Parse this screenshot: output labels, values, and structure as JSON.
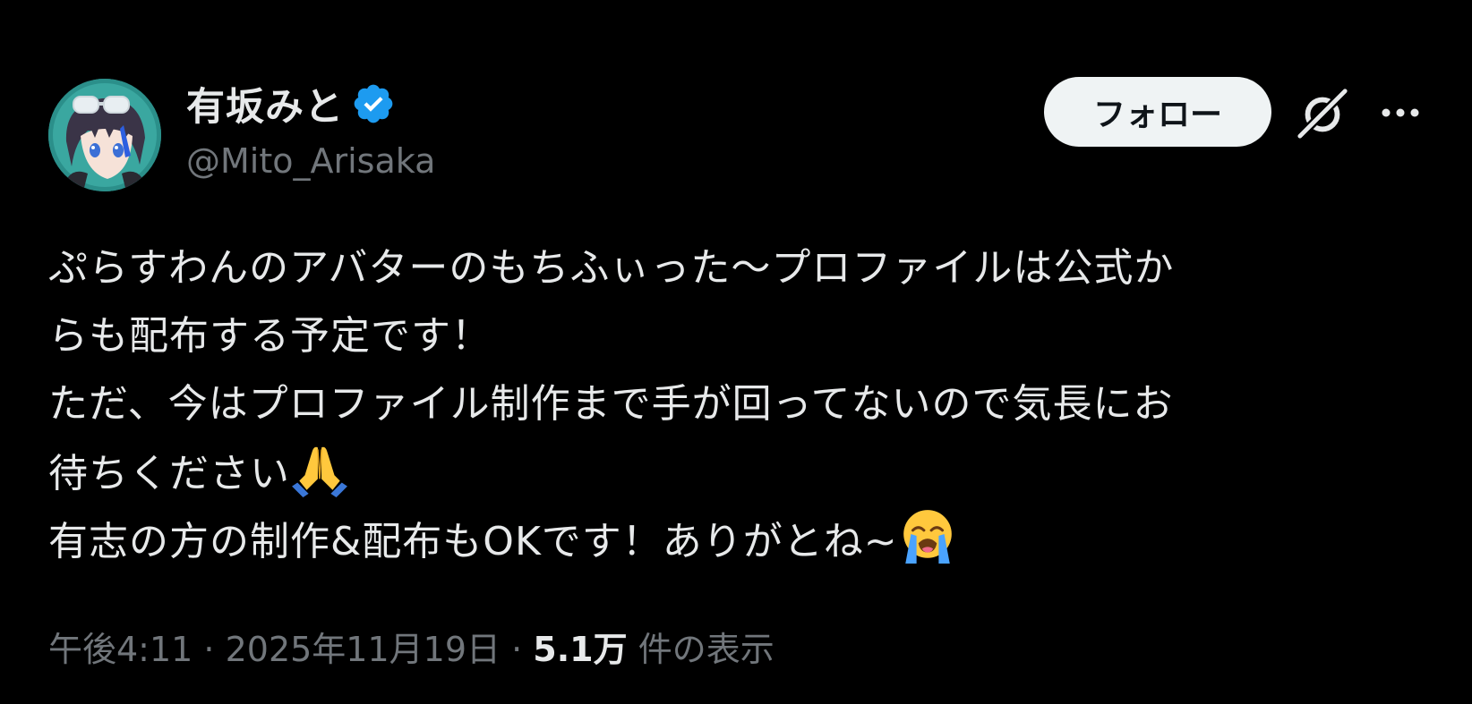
{
  "author": {
    "display_name": "有坂みと",
    "handle": "@Mito_Arisaka",
    "verified": true,
    "avatar_icon": "anime-avatar"
  },
  "actions": {
    "follow_label": "フォロー",
    "grok_icon": "grok-icon",
    "more_icon": "more-icon"
  },
  "tweet": {
    "lines": [
      "ぷらすわんのアバターのもちふぃった〜プロファイルは公式か",
      "らも配布する予定です！",
      "ただ、今はプロファイル制作まで手が回ってないので気長にお",
      "待ちください",
      "有志の方の制作&配布もOKです！ありがとね~"
    ],
    "emojis": [
      "folded-hands-emoji",
      "loudly-crying-face-emoji"
    ]
  },
  "meta": {
    "time": "午後4:11",
    "separator": " · ",
    "date": "2025年11月19日",
    "views_count": "5.1万",
    "views_label": "件の表示"
  },
  "colors": {
    "background": "#000000",
    "text": "#e7e9ea",
    "secondary": "#71767b",
    "verified": "#1d9bf0",
    "follow_bg": "#eff3f4"
  }
}
